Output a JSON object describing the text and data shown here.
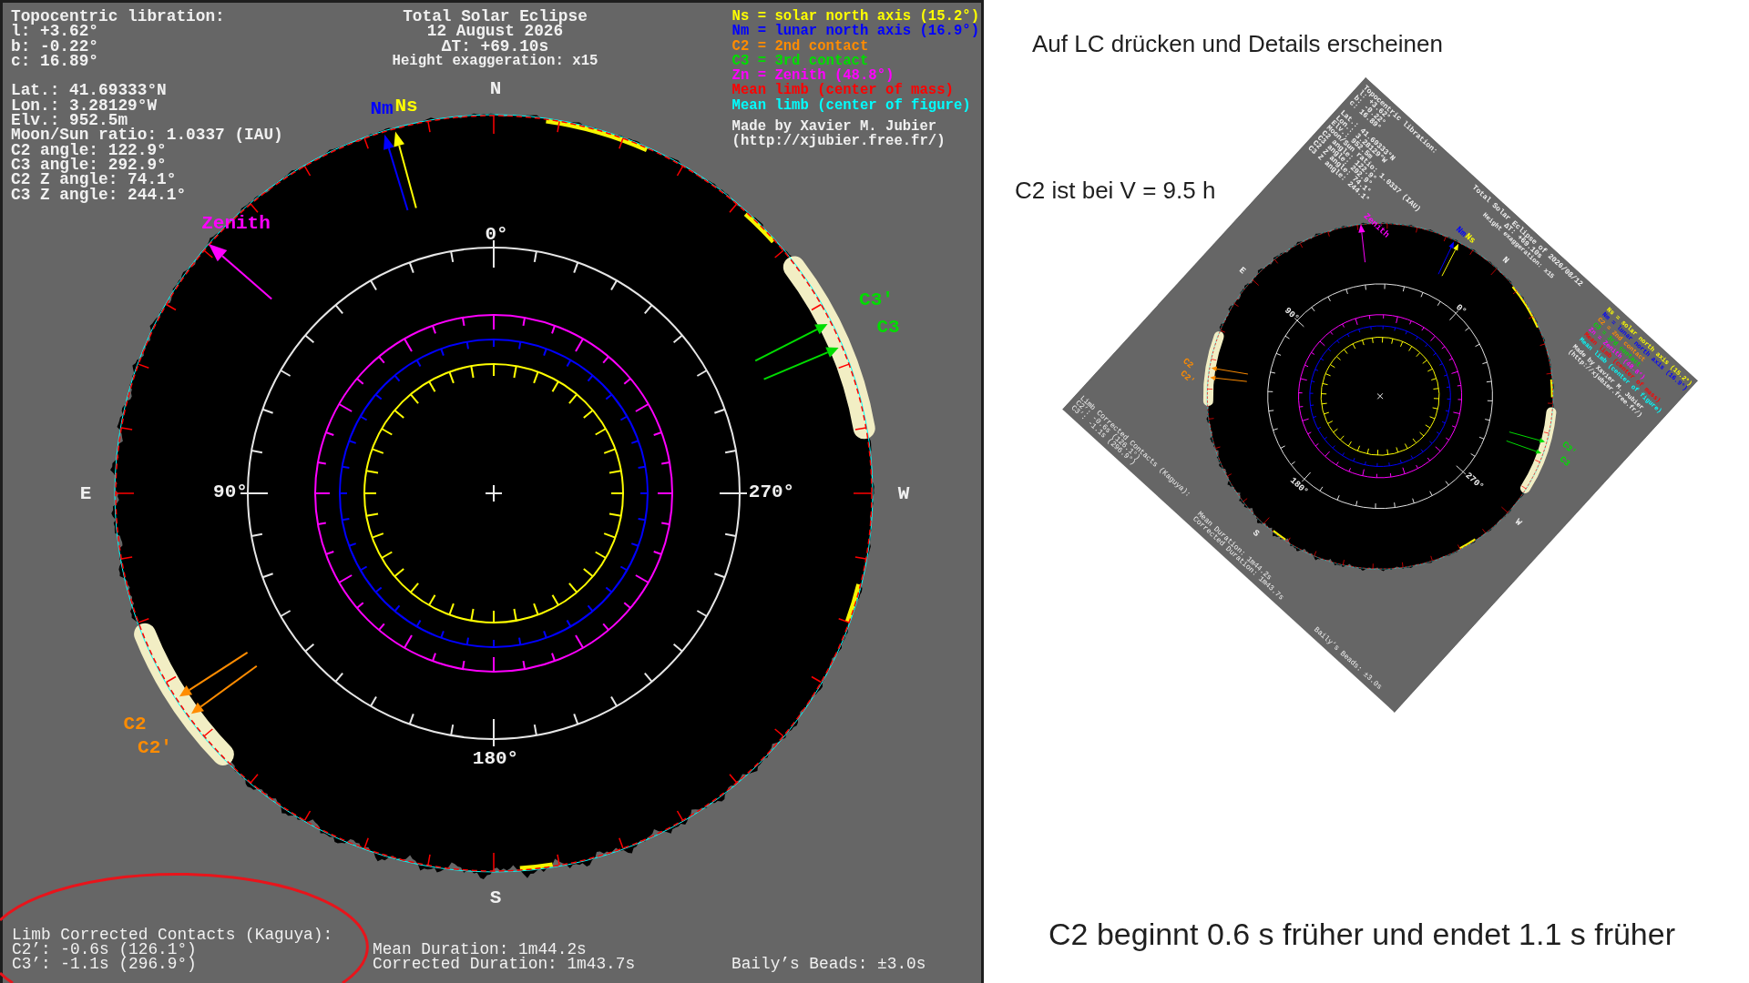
{
  "eclipse_panel": {
    "libration": {
      "heading": "Topocentric libration:",
      "values": [
        "l: +3.62°",
        "b: -0.22°",
        "c: 16.89°"
      ]
    },
    "observer": [
      "Lat.: 41.69333°N",
      "Lon.: 3.28129°W",
      "Elv.: 952.5m",
      "Moon/Sun ratio: 1.0337 (IAU)",
      "C2 angle: 122.9°",
      "C3 angle: 292.9°",
      "C2 Z angle: 74.1°",
      "C3 Z angle: 244.1°"
    ],
    "title": [
      "Total Solar Eclipse",
      "12 August 2026",
      "ΔT: +69.10s"
    ],
    "subtitle": "Height exaggeration: x15",
    "legend": [
      {
        "text": "Ns = solar north axis (15.2°)",
        "color": "#ffff00"
      },
      {
        "text": "Nm = lunar north axis (16.9°)",
        "color": "#0000ff"
      },
      {
        "text": "C2 = 2nd contact",
        "color": "#ff8c00"
      },
      {
        "text": "C3 = 3rd contact",
        "color": "#00dd00"
      },
      {
        "text": "Zn = Zenith (48.8°)",
        "color": "#ff00ff"
      },
      {
        "text": "Mean limb (center of mass)",
        "color": "#ff0000"
      },
      {
        "text": "Mean limb (center of figure)",
        "color": "#00ffff"
      }
    ],
    "credit": [
      "Made by Xavier M. Jubier",
      "(http://xjubier.free.fr/)"
    ],
    "compass": [
      "N",
      "E",
      "S",
      "W"
    ],
    "angle_labels": [
      "0°",
      "90°",
      "180°",
      "270°"
    ],
    "markers": [
      {
        "kind": "axis",
        "label": "Nm",
        "color": "#0000ff"
      },
      {
        "kind": "axis",
        "label": "Ns",
        "color": "#ffff00"
      },
      {
        "kind": "zenith",
        "label": "Zenith",
        "color": "#ff00ff"
      },
      {
        "kind": "contact",
        "label": "C2",
        "color": "#ff8c00"
      },
      {
        "kind": "contact",
        "label": "C2'",
        "color": "#ff8c00"
      },
      {
        "kind": "contact",
        "label": "C3'",
        "color": "#00dd00"
      },
      {
        "kind": "contact",
        "label": "C3",
        "color": "#00dd00"
      }
    ],
    "contacts_heading": "Limb Corrected Contacts (Kaguya):",
    "contacts": [
      "C2’: -0.6s (126.1°)",
      "C3’: -1.1s (296.9°)"
    ],
    "mean_duration": "Mean Duration: 1m44.2s",
    "corrected_duration": "Corrected Duration: 1m43.7s",
    "baily_beads": "Baily’s Beads: ±3.0s"
  },
  "instruction": "Auf LC drücken und Details erscheinen",
  "note": "C2 ist bei V = 9.5 h",
  "rotated_copy": {
    "libration": {
      "heading": "Topocentric libration:",
      "values": [
        "l: +3.62°",
        "b: -0.22°",
        "c: 16.89°"
      ]
    },
    "observer": [
      "Lat.: 41.69333°N",
      "Lon.: 3.28129°W",
      "Elv.: 952.5m",
      "Moon/Sun ratio: 1.0337 (IAU)",
      "C2 angle: 122.9°",
      "C3 angle: 292.9°",
      "C2 Z angle: 74.1°",
      "C3 Z angle: 244.1°"
    ],
    "title": [
      "Total Solar Eclipse of 2026/08/12",
      "ΔT: +69.10s"
    ],
    "subtitle": "Height exaggeration: x15",
    "legend": [
      "Ns = solar north axis (15.2°)",
      "Nm = lunar north axis (16.9°)",
      "C2 = 2nd contact",
      "C3 = 3rd contact",
      "Zn = Zenith (48.8°)",
      "Mean limb (center of mass)",
      "Mean limb (center of figure)"
    ],
    "credit": [
      "Made by Xavier M. Jubier",
      "(http://xjubier.free.fr/)"
    ],
    "compass": [
      "N",
      "E",
      "S",
      "W"
    ],
    "angle_labels": [
      "0°",
      "90°",
      "180°",
      "270°"
    ],
    "markers": [
      {
        "kind": "axis",
        "label": "Nm"
      },
      {
        "kind": "axis",
        "label": "Ns"
      },
      {
        "kind": "zenith",
        "label": "Zenith"
      },
      {
        "kind": "contact",
        "label": "C2"
      },
      {
        "kind": "contact",
        "label": "C2'"
      },
      {
        "kind": "contact",
        "label": "C3'"
      },
      {
        "kind": "contact",
        "label": "C3"
      }
    ],
    "contacts_heading": "Limb Corrected Contacts (Kaguya):",
    "contacts": [
      "C2’: -0.6s (126.1°)",
      "C3’: -1.1s (296.9°)"
    ],
    "mean_duration": "Mean Duration: 1m44.2s",
    "corrected_duration": "Corrected Duration: 1m43.7s",
    "baily_beads": "Baily’s Beads: ±3.0s"
  },
  "conclusion": "C2 beginnt 0.6 s früher und endet 1.1 s früher"
}
